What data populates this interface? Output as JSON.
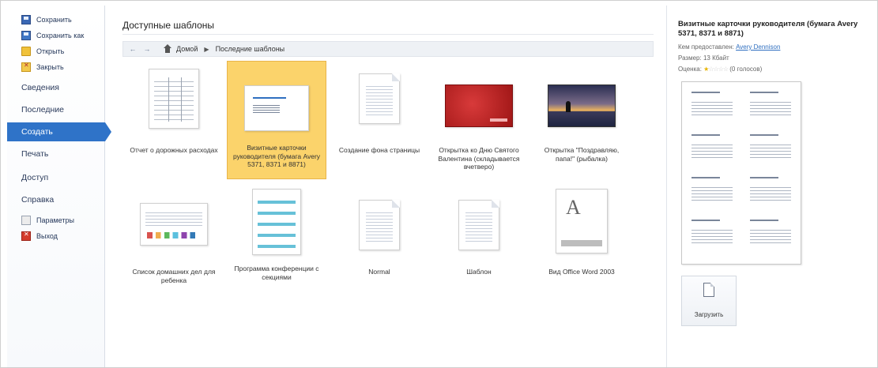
{
  "sidebar": {
    "items": [
      {
        "label": "Сохранить",
        "icon": "save-icon"
      },
      {
        "label": "Сохранить как",
        "icon": "save-as-icon"
      },
      {
        "label": "Открыть",
        "icon": "open-folder-icon"
      },
      {
        "label": "Закрыть",
        "icon": "close-file-icon"
      },
      {
        "label": "Сведения"
      },
      {
        "label": "Последние"
      },
      {
        "label": "Создать",
        "active": true
      },
      {
        "label": "Печать"
      },
      {
        "label": "Доступ"
      },
      {
        "label": "Справка"
      },
      {
        "label": "Параметры",
        "icon": "options-icon"
      },
      {
        "label": "Выход",
        "icon": "exit-icon"
      }
    ],
    "active_color": "#2f73c8"
  },
  "main": {
    "title": "Доступные шаблоны",
    "breadcrumb": {
      "back": "←",
      "forward": "→",
      "home": "Домой",
      "separator": "▶",
      "current": "Последние шаблоны"
    },
    "templates": [
      {
        "label": "Отчет о дорожных расходах"
      },
      {
        "label": "Визитные карточки руководителя (бумага Avery 5371, 8371 и 8871)",
        "selected": true
      },
      {
        "label": "Создание фона страницы"
      },
      {
        "label": "Открытка ко Дню Святого Валентина (складывается вчетверо)"
      },
      {
        "label": "Открытка \"Поздравляю, папа!\" (рыбалка)"
      },
      {
        "label": "Список домашних дел для ребенка"
      },
      {
        "label": "Программа конференции с секциями"
      },
      {
        "label": "Normal"
      },
      {
        "label": "Шаблон"
      },
      {
        "label": "Вид Office Word 2003"
      }
    ],
    "selected_color": "#fbd36b"
  },
  "details": {
    "title": "Визитные карточки руководителя (бумага Avery 5371, 8371 и 8871)",
    "provider_label": "Кем предоставлен:",
    "provider": "Avery Dennison",
    "size_label": "Размер:",
    "size": "13 Кбайт",
    "rating_label": "Оценка:",
    "rating_stars": 1,
    "rating_count": "(0 голосов)",
    "upload_label": "Загрузить"
  }
}
